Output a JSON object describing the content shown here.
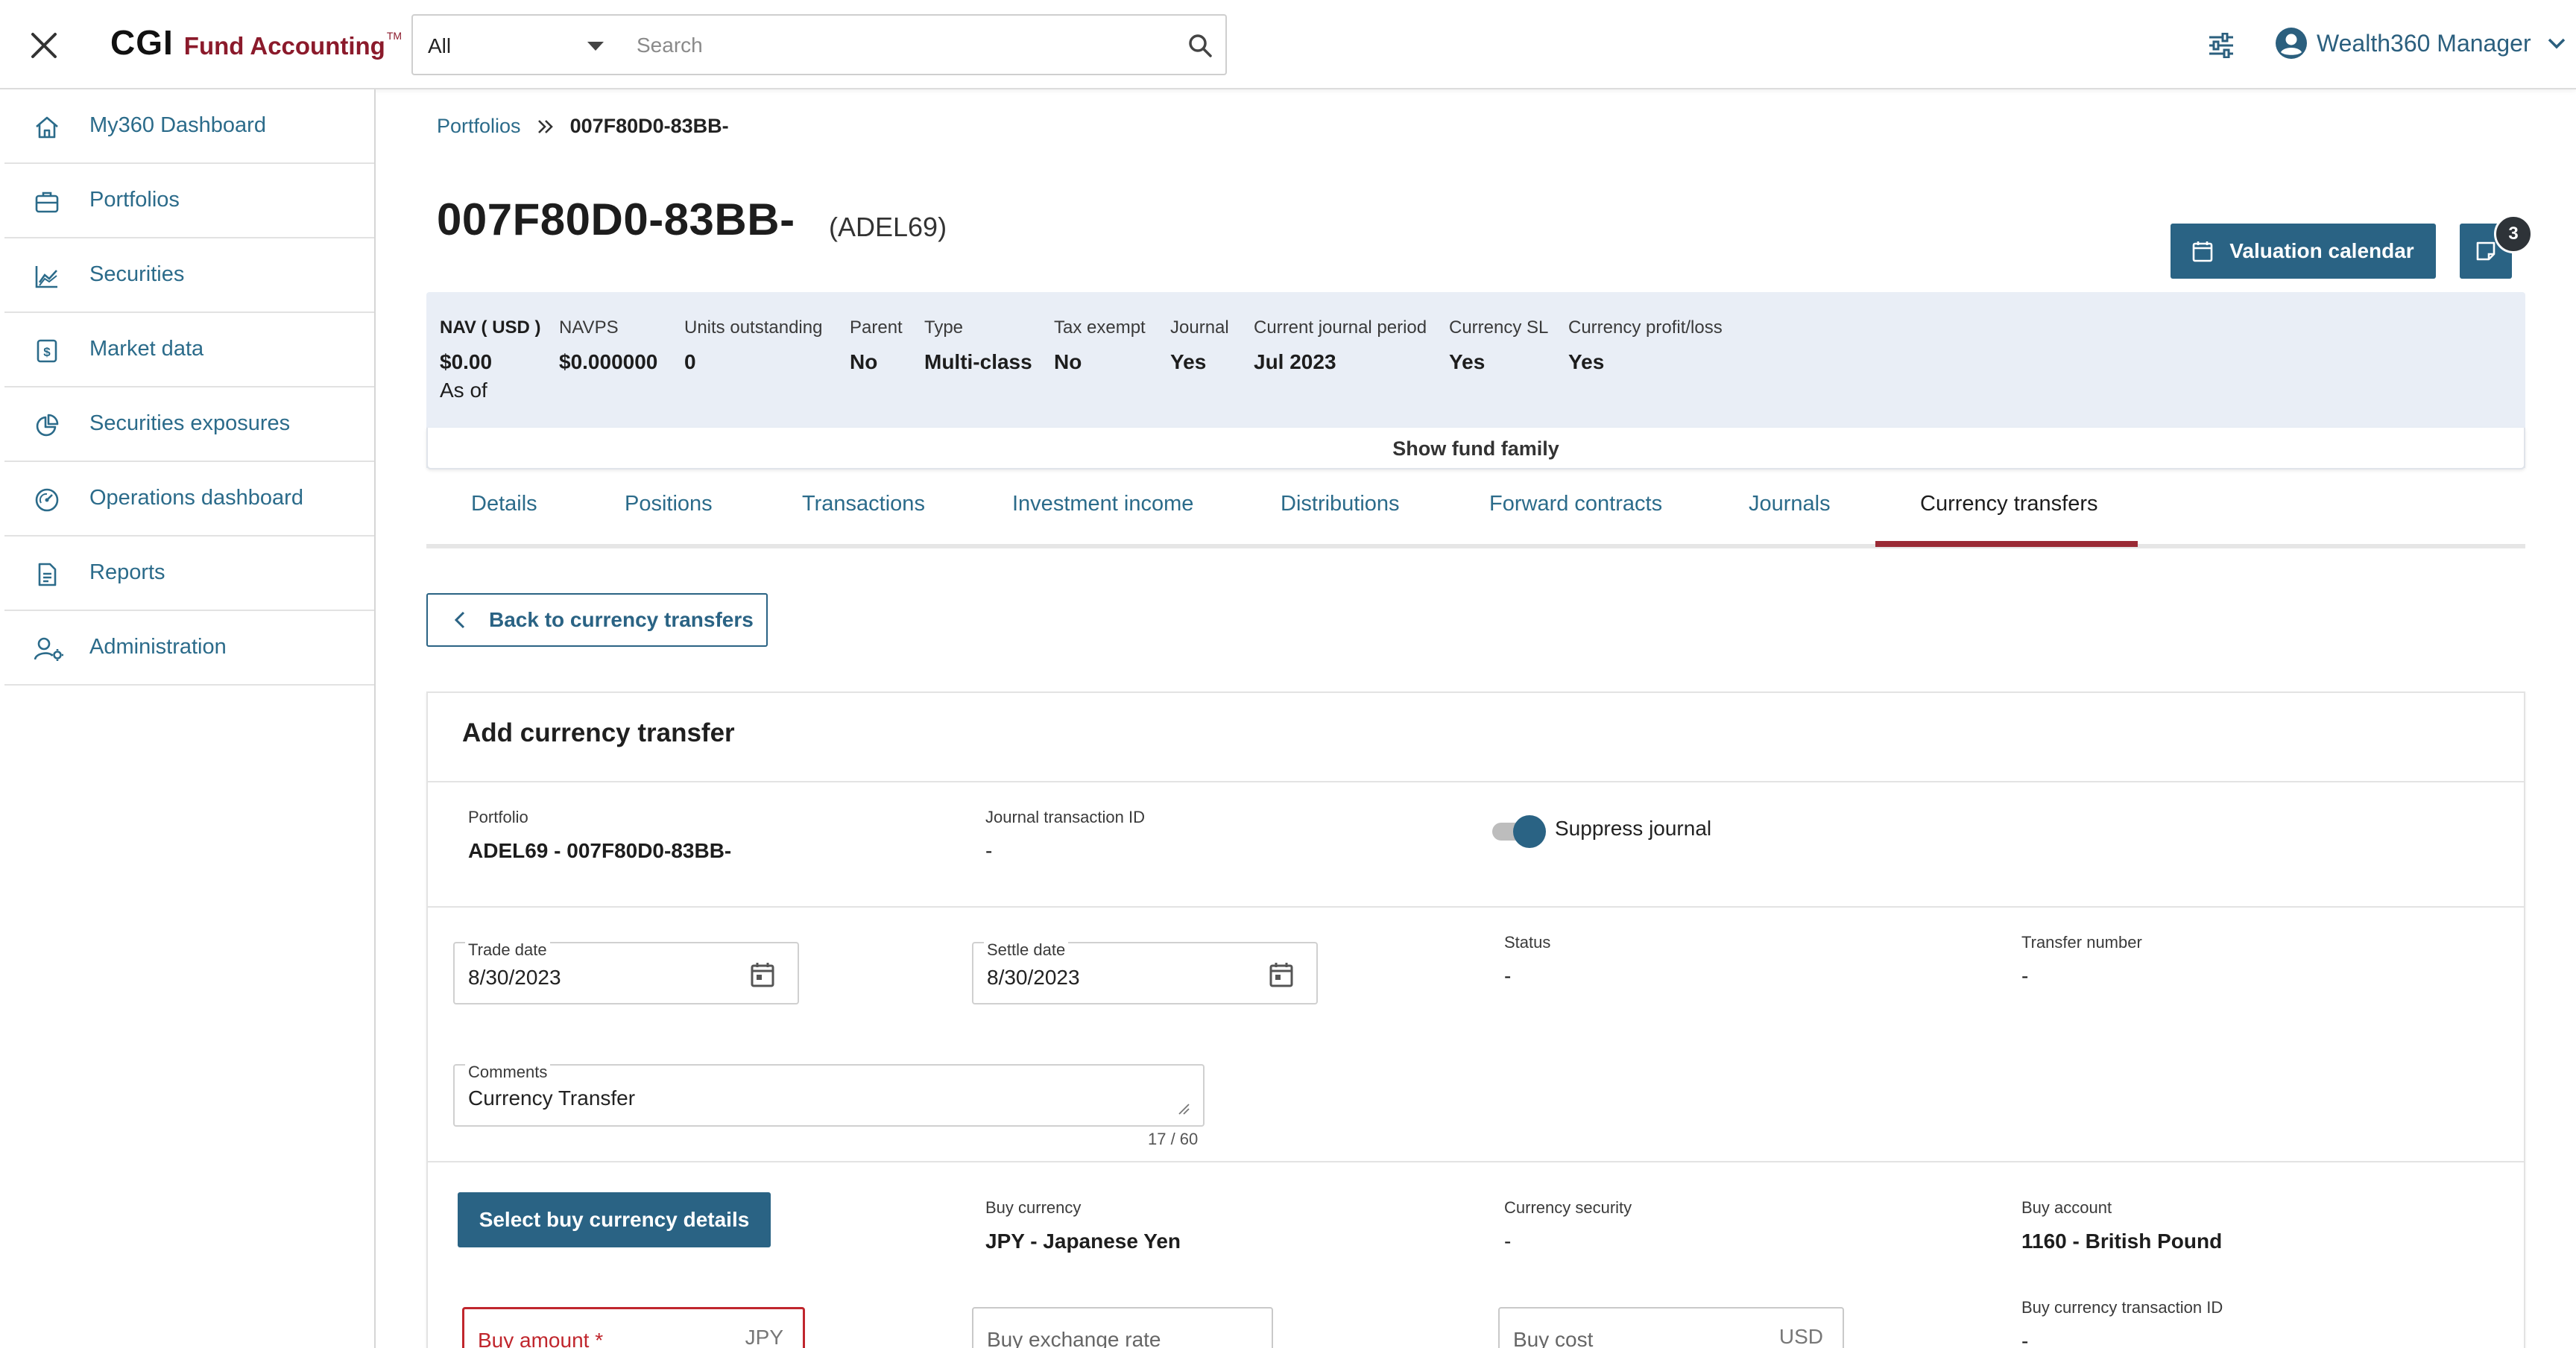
{
  "app": {
    "logo_brand": "CGI",
    "logo_product": "Fund Accounting",
    "logo_tm": "TM"
  },
  "topbar": {
    "scope_value": "All",
    "search_placeholder": "Search",
    "user_name": "Wealth360 Manager"
  },
  "sidebar": {
    "items": [
      {
        "label": "My360 Dashboard",
        "icon": "home-icon"
      },
      {
        "label": "Portfolios",
        "icon": "briefcase-icon"
      },
      {
        "label": "Securities",
        "icon": "chart-icon"
      },
      {
        "label": "Market data",
        "icon": "dollar-doc-icon"
      },
      {
        "label": "Securities exposures",
        "icon": "pie-chart-icon"
      },
      {
        "label": "Operations dashboard",
        "icon": "gauge-icon"
      },
      {
        "label": "Reports",
        "icon": "report-icon"
      },
      {
        "label": "Administration",
        "icon": "user-gear-icon"
      }
    ]
  },
  "breadcrumb": {
    "parent": "Portfolios",
    "current": "007F80D0-83BB-"
  },
  "header": {
    "title": "007F80D0-83BB-",
    "subtitle": "(ADEL69)",
    "valuation_calendar_label": "Valuation calendar",
    "notes_badge": "3"
  },
  "summary": {
    "fields": [
      {
        "label": "NAV ( USD )",
        "value": "$0.00",
        "extra": "As of"
      },
      {
        "label": "NAVPS",
        "value": "$0.000000"
      },
      {
        "label": "Units outstanding",
        "value": "0"
      },
      {
        "label": "Parent",
        "value": "No"
      },
      {
        "label": "Type",
        "value": "Multi-class"
      },
      {
        "label": "Tax exempt",
        "value": "No"
      },
      {
        "label": "Journal",
        "value": "Yes"
      },
      {
        "label": "Current journal period",
        "value": "Jul 2023"
      },
      {
        "label": "Currency SL",
        "value": "Yes"
      },
      {
        "label": "Currency profit/loss",
        "value": "Yes"
      }
    ],
    "show_fund_family": "Show fund family"
  },
  "tabs": [
    {
      "label": "Details"
    },
    {
      "label": "Positions"
    },
    {
      "label": "Transactions"
    },
    {
      "label": "Investment income"
    },
    {
      "label": "Distributions"
    },
    {
      "label": "Forward contracts"
    },
    {
      "label": "Journals"
    },
    {
      "label": "Currency transfers",
      "active": true
    }
  ],
  "back_button": "Back to currency transfers",
  "form": {
    "title": "Add currency transfer",
    "portfolio_label": "Portfolio",
    "portfolio_value": "ADEL69 - 007F80D0-83BB-",
    "journal_txn_label": "Journal transaction ID",
    "journal_txn_value": "-",
    "suppress_journal_label": "Suppress journal",
    "suppress_journal_on": true,
    "trade_date_label": "Trade date",
    "trade_date_value": "8/30/2023",
    "settle_date_label": "Settle date",
    "settle_date_value": "8/30/2023",
    "status_label": "Status",
    "status_value": "-",
    "transfer_number_label": "Transfer number",
    "transfer_number_value": "-",
    "comments_label": "Comments",
    "comments_value": "Currency Transfer",
    "comments_count": "17 / 60",
    "select_buy_label": "Select buy currency details",
    "buy_currency_label": "Buy currency",
    "buy_currency_value": "JPY - Japanese Yen",
    "currency_security_label": "Currency security",
    "currency_security_value": "-",
    "buy_account_label": "Buy account",
    "buy_account_value": "1160 - British Pound",
    "buy_amount_placeholder": "Buy amount *",
    "buy_amount_unit": "JPY",
    "buy_exchange_rate_placeholder": "Buy exchange rate",
    "buy_cost_placeholder": "Buy cost",
    "buy_cost_unit": "USD",
    "buy_currency_txn_label": "Buy currency transaction ID",
    "buy_currency_txn_value": "-"
  },
  "colors": {
    "accent": "#2a6384",
    "brand": "#8b1a2b",
    "active_tab": "#9a2a35",
    "error": "#c0262d"
  }
}
